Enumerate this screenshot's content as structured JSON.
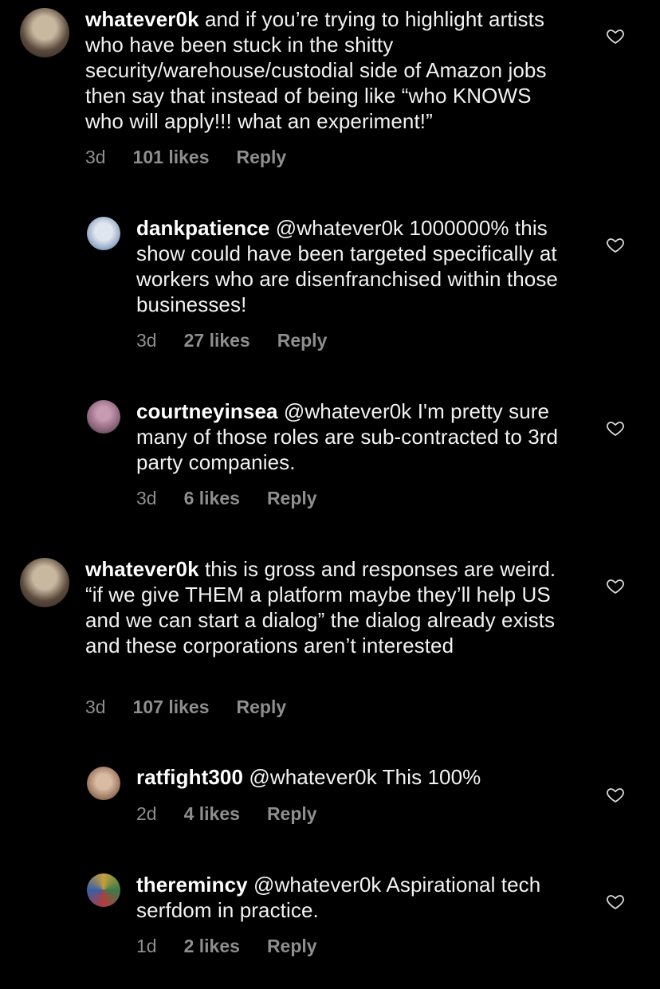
{
  "comments": [
    {
      "username": "whatever0k",
      "body": " and if you’re trying to highlight artists who have been stuck in the shitty security/warehouse/custodial side of Amazon jobs then say that instead of being like “who KNOWS who will apply!!! what an experiment!”",
      "age": "3d",
      "likes": "101 likes",
      "reply_label": "Reply",
      "avatar_colors": [
        "#5a4a3c",
        "#c9b8a0"
      ]
    },
    {
      "username": "dankpatience",
      "body": " @whatever0k 1000000% this show could have been targeted specifically at workers who are disenfranchised within those businesses!",
      "age": "3d",
      "likes": "27 likes",
      "reply_label": "Reply",
      "avatar_colors": [
        "#8fa4c4",
        "#dfe6ef"
      ]
    },
    {
      "username": "courtneyinsea",
      "body": " @whatever0k I'm pretty sure many of those roles are sub-contracted to 3rd party companies.",
      "age": "3d",
      "likes": "6 likes",
      "reply_label": "Reply",
      "avatar_colors": [
        "#9a6f86",
        "#4a4a52"
      ]
    },
    {
      "username": "whatever0k",
      "body": " this is gross and responses are weird. “if we give THEM a platform maybe they’ll help US and we can start a dialog” the dialog already exists and these corporations aren’t interested",
      "age": "3d",
      "likes": "107 likes",
      "reply_label": "Reply",
      "avatar_colors": [
        "#5a4a3c",
        "#c9b8a0"
      ]
    },
    {
      "username": "ratfight300",
      "body": " @whatever0k This 100%",
      "age": "2d",
      "likes": "4 likes",
      "reply_label": "Reply",
      "avatar_colors": [
        "#c7a58c",
        "#6b5c52"
      ]
    },
    {
      "username": "theremincy",
      "body": " @whatever0k Aspirational tech serfdom in practice.",
      "age": "1d",
      "likes": "2 likes",
      "reply_label": "Reply",
      "avatar_colors": [
        "#c9a03a",
        "#3b7a4a"
      ]
    }
  ],
  "icons": {
    "like": "heart-outline-icon"
  },
  "colors": {
    "background": "#000000",
    "text": "#f2f2f2",
    "meta": "#8e8e8e"
  }
}
